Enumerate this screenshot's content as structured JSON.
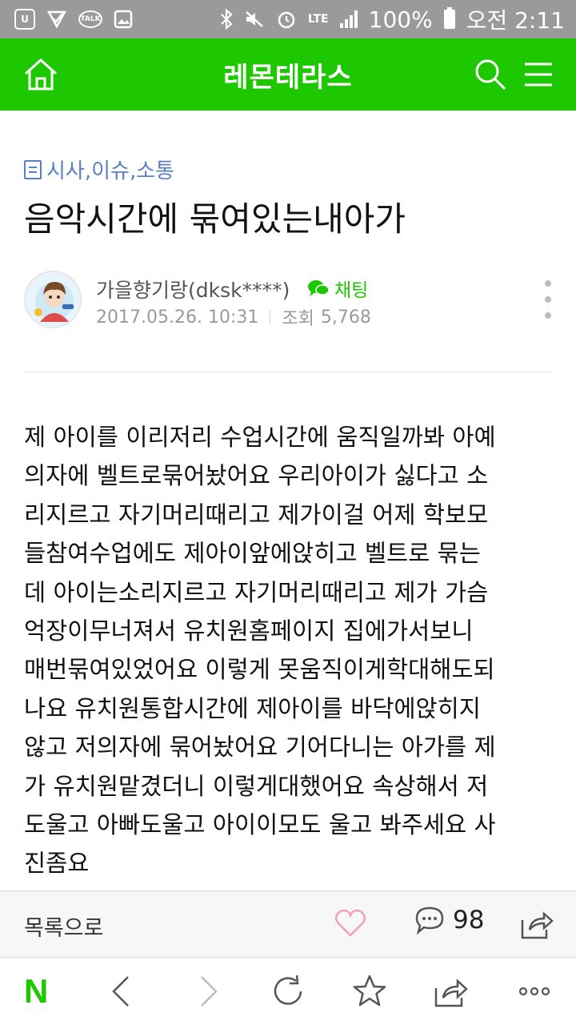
{
  "status_bar": {
    "kakaotalk_icon_label": "TALK",
    "network": "LTE",
    "battery": "100%",
    "time": "오전 2:11"
  },
  "header": {
    "title": "레몬테라스"
  },
  "post": {
    "category": "시사,이슈,소통",
    "title": "음악시간에 묶여있는내아가",
    "author": "가을향기랑(dksk****)",
    "chat_label": "채팅",
    "date": "2017.05.26. 10:31",
    "views_label": "조회",
    "views": "5,768",
    "body_lines": [
      "제 아이를 이리저리 수업시간에 움직일까봐 아예",
      "의자에 벨트로묶어놨어요 우리아이가 싫다고 소",
      "리지르고 자기머리때리고 제가이걸 어제 학보모",
      "들참여수업에도 제아이앞에앉히고 벨트로 묶는",
      "데 아이는소리지르고 자기머리때리고 제가 가슴",
      "억장이무너져서 유치원홈페이지 집에가서보니",
      "매번묶여있었어요 이렇게 못움직이게학대해도되",
      "나요 유치원통합시간에 제아이를 바닥에앉히지",
      "않고 저의자에 묶어놨어요 기어다니는 아가를 제",
      "가 유치원맡겼더니 이렇게대했어요 속상해서 저",
      "도울고 아빠도울고 아이이모도 울고 봐주세요 사",
      "진좀요"
    ]
  },
  "action_bar": {
    "list_label": "목록으로",
    "comment_count": "98"
  },
  "browser_nav": {
    "logo": "N"
  },
  "colors": {
    "brand_green": "#1ec800",
    "category_blue": "#5b7fc4",
    "like_pink": "#f4a0b0"
  }
}
